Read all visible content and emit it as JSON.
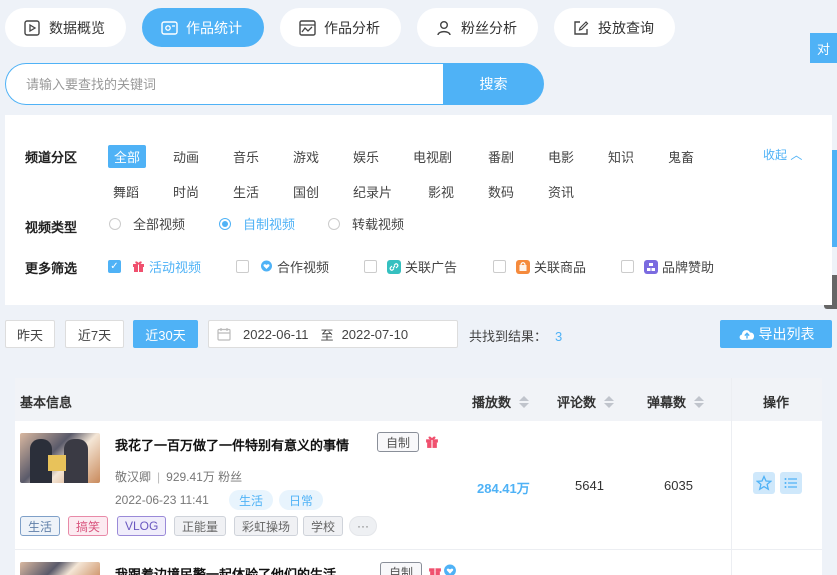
{
  "tabs": [
    {
      "label": "数据概览",
      "icon": "play-square-icon",
      "active": false
    },
    {
      "label": "作品统计",
      "icon": "video-camera-icon",
      "active": true
    },
    {
      "label": "作品分析",
      "icon": "chart-window-icon",
      "active": false
    },
    {
      "label": "粉丝分析",
      "icon": "user-icon",
      "active": false
    },
    {
      "label": "投放查询",
      "icon": "edit-icon",
      "active": false
    }
  ],
  "edge": {
    "button_label": "对"
  },
  "search": {
    "placeholder": "请输入要查找的关键词",
    "button_label": "搜索"
  },
  "filter": {
    "channel_label": "频道分区",
    "channels": [
      "全部",
      "动画",
      "音乐",
      "游戏",
      "娱乐",
      "电视剧",
      "番剧",
      "电影",
      "知识",
      "鬼畜",
      "舞蹈",
      "时尚",
      "生活",
      "国创",
      "纪录片",
      "影视",
      "数码",
      "资讯"
    ],
    "active_channel": "全部",
    "collapse_label": "收起",
    "video_type_label": "视频类型",
    "video_types": [
      "全部视频",
      "自制视频",
      "转载视频"
    ],
    "active_video_type": "自制视频",
    "more_label": "更多筛选",
    "more_options": [
      {
        "label": "活动视频",
        "checked": true,
        "icon": "gift-icon",
        "color": "#f0506e"
      },
      {
        "label": "合作视频",
        "checked": false,
        "icon": "heart-bubble-icon",
        "color": "#4fb2f6"
      },
      {
        "label": "关联广告",
        "checked": false,
        "icon": "link-icon",
        "color": "#35c0c0"
      },
      {
        "label": "关联商品",
        "checked": false,
        "icon": "shopping-bag-icon",
        "color": "#f58a3c"
      },
      {
        "label": "品牌赞助",
        "checked": false,
        "icon": "brand-icon",
        "color": "#7b6be0"
      }
    ]
  },
  "dates": {
    "quick": [
      "昨天",
      "近7天",
      "近30天"
    ],
    "active": "近30天",
    "start": "2022-06-11",
    "separator": "至",
    "end": "2022-07-10",
    "result_label": "共找到结果：",
    "result_count": "3",
    "export_label": "导出列表"
  },
  "table": {
    "headers": {
      "basic": "基本信息",
      "plays": "播放数",
      "comments": "评论数",
      "danmaku": "弹幕数",
      "ops": "操作"
    },
    "rows": [
      {
        "title": "我花了一百万做了一件特别有意义的事情",
        "badge": "自制",
        "author": "敬汉卿",
        "fans": "929.41万 粉丝",
        "date": "2022-06-23 11:41",
        "categories": [
          "生活",
          "日常"
        ],
        "tags": [
          "生活",
          "搞笑",
          "VLOG",
          "正能量",
          "彩虹操场",
          "学校",
          "···"
        ],
        "plays": "284.41万",
        "comments": "5641",
        "danmaku": "6035"
      },
      {
        "title": "我跟着边境民警一起体验了他们的生活",
        "badge": "自制"
      }
    ]
  }
}
